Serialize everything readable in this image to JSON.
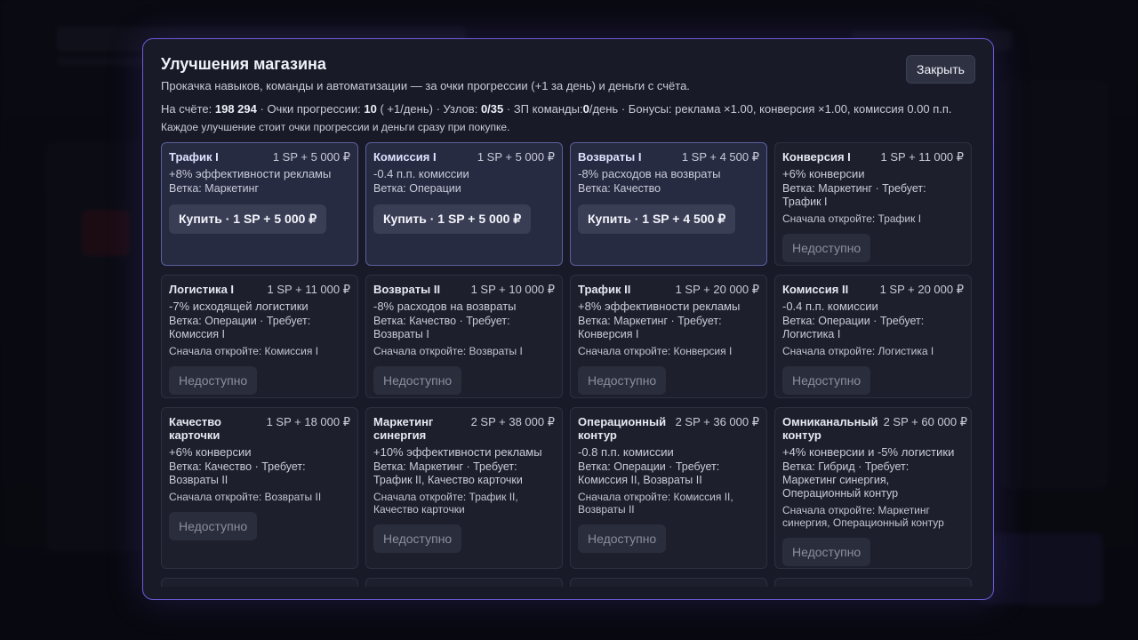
{
  "modal": {
    "title": "Улучшения магазина",
    "description": "Прокачка навыков, команды и автоматизации — за очки прогрессии (+1 за день) и деньги с счёта.",
    "close_label": "Закрыть",
    "stats": {
      "balance_label": "На счёте:",
      "balance": "198 294",
      "progress_label": "· Очки прогрессии:",
      "progress": "10",
      "progress_rate": "( +1/день)",
      "nodes_label": "· Узлов:",
      "nodes": "0/35",
      "salary_label": "· ЗП команды:",
      "salary": "0",
      "salary_unit": "/день",
      "bonuses": "· Бонусы: реклама ×1.00, конверсия ×1.00, комиссия 0.00 п.п."
    },
    "note": "Каждое улучшение стоит очки прогрессии и деньги сразу при покупке."
  },
  "upgrades": [
    {
      "name": "Трафик I",
      "cost": "1 SP + 5 000 ₽",
      "effect": "+8% эффективности рекламы",
      "branch": "Ветка: Маркетинг",
      "lock": "",
      "button": "Купить · 1 SP + 5 000 ₽",
      "available": true
    },
    {
      "name": "Комиссия I",
      "cost": "1 SP + 5 000 ₽",
      "effect": "-0.4 п.п. комиссии",
      "branch": "Ветка: Операции",
      "lock": "",
      "button": "Купить · 1 SP + 5 000 ₽",
      "available": true
    },
    {
      "name": "Возвраты I",
      "cost": "1 SP + 4 500 ₽",
      "effect": "-8% расходов на возвраты",
      "branch": "Ветка: Качество",
      "lock": "",
      "button": "Купить · 1 SP + 4 500 ₽",
      "available": true
    },
    {
      "name": "Конверсия I",
      "cost": "1 SP + 11 000 ₽",
      "effect": "+6% конверсии",
      "branch": "Ветка: Маркетинг · Требует: Трафик I",
      "lock": "Сначала откройте: Трафик I",
      "button": "Недоступно",
      "available": false
    },
    {
      "name": "Логистика I",
      "cost": "1 SP + 11 000 ₽",
      "effect": "-7% исходящей логистики",
      "branch": "Ветка: Операции · Требует: Комиссия I",
      "lock": "Сначала откройте: Комиссия I",
      "button": "Недоступно",
      "available": false
    },
    {
      "name": "Возвраты II",
      "cost": "1 SP + 10 000 ₽",
      "effect": "-8% расходов на возвраты",
      "branch": "Ветка: Качество · Требует: Возвраты I",
      "lock": "Сначала откройте: Возвраты I",
      "button": "Недоступно",
      "available": false
    },
    {
      "name": "Трафик II",
      "cost": "1 SP + 20 000 ₽",
      "effect": "+8% эффективности рекламы",
      "branch": "Ветка: Маркетинг · Требует: Конверсия I",
      "lock": "Сначала откройте: Конверсия I",
      "button": "Недоступно",
      "available": false
    },
    {
      "name": "Комиссия II",
      "cost": "1 SP + 20 000 ₽",
      "effect": "-0.4 п.п. комиссии",
      "branch": "Ветка: Операции · Требует: Логистика I",
      "lock": "Сначала откройте: Логистика I",
      "button": "Недоступно",
      "available": false
    },
    {
      "name": "Качество карточки",
      "cost": "1 SP + 18 000 ₽",
      "effect": "+6% конверсии",
      "branch": "Ветка: Качество · Требует: Возвраты II",
      "lock": "Сначала откройте: Возвраты II",
      "button": "Недоступно",
      "available": false
    },
    {
      "name": "Маркетинг синергия",
      "cost": "2 SP + 38 000 ₽",
      "effect": "+10% эффективности рекламы",
      "branch": "Ветка: Маркетинг · Требует: Трафик II, Качество карточки",
      "lock": "Сначала откройте: Трафик II, Качество карточки",
      "button": "Недоступно",
      "available": false
    },
    {
      "name": "Операционный контур",
      "cost": "2 SP + 36 000 ₽",
      "effect": "-0.8 п.п. комиссии",
      "branch": "Ветка: Операции · Требует: Комиссия II, Возвраты II",
      "lock": "Сначала откройте: Комиссия II, Возвраты II",
      "button": "Недоступно",
      "available": false
    },
    {
      "name": "Омниканальный контур",
      "cost": "2 SP + 60 000 ₽",
      "effect": "+4% конверсии и -5% логистики",
      "branch": "Ветка: Гибрид · Требует: Маркетинг синергия, Операционный контур",
      "lock": "Сначала откройте: Маркетинг синергия, Операционный контур",
      "button": "Недоступно",
      "available": false
    }
  ]
}
